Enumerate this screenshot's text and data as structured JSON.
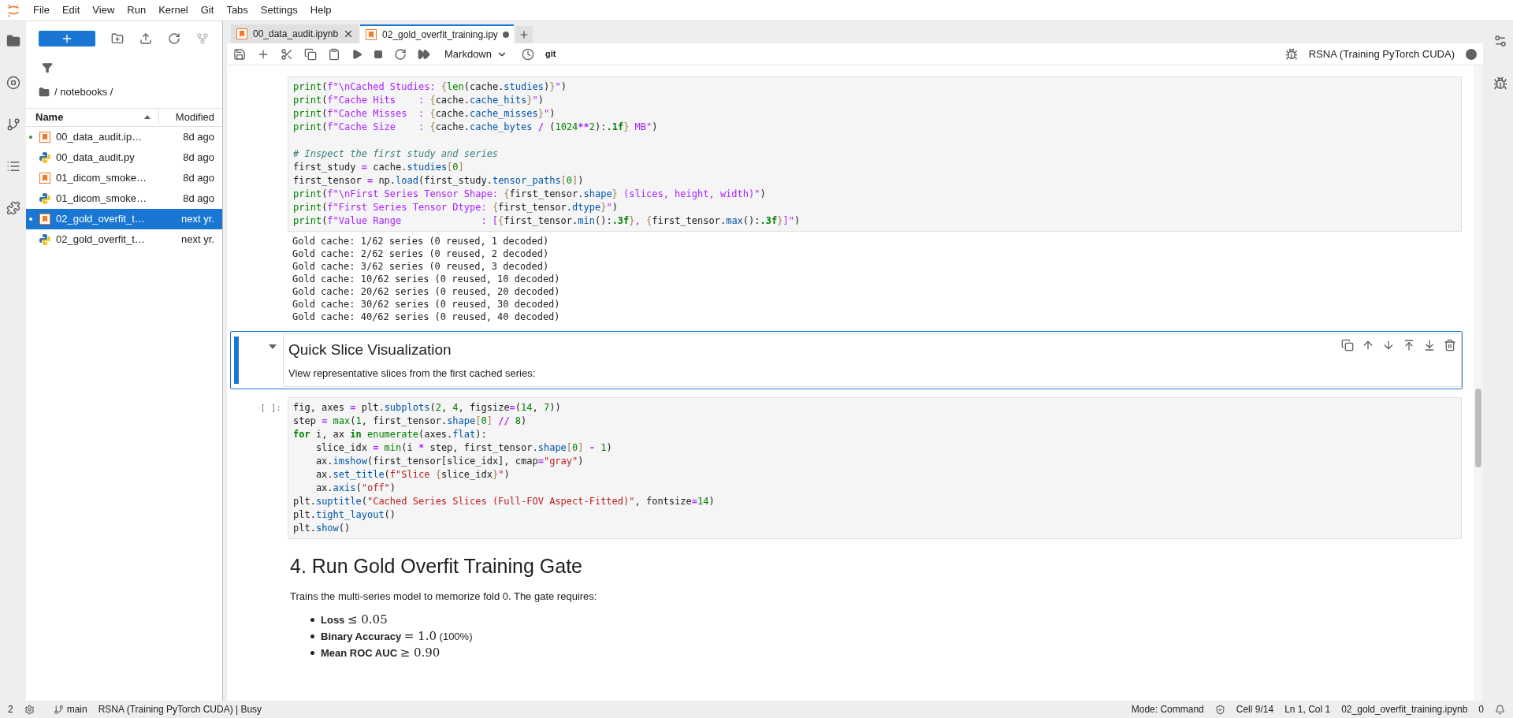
{
  "menu": [
    "File",
    "Edit",
    "View",
    "Run",
    "Kernel",
    "Git",
    "Tabs",
    "Settings",
    "Help"
  ],
  "file_browser": {
    "breadcrumb": "/ notebooks /",
    "columns": {
      "name": "Name",
      "modified": "Modified"
    },
    "files": [
      {
        "name": "00_data_audit.ip…",
        "modified": "8d ago",
        "kind": "notebook",
        "running": true,
        "selected": false
      },
      {
        "name": "00_data_audit.py",
        "modified": "8d ago",
        "kind": "python",
        "running": false,
        "selected": false
      },
      {
        "name": "01_dicom_smoke…",
        "modified": "8d ago",
        "kind": "notebook",
        "running": false,
        "selected": false
      },
      {
        "name": "01_dicom_smoke…",
        "modified": "8d ago",
        "kind": "python",
        "running": false,
        "selected": false
      },
      {
        "name": "02_gold_overfit_t…",
        "modified": "next yr.",
        "kind": "notebook",
        "running": true,
        "selected": true
      },
      {
        "name": "02_gold_overfit_t…",
        "modified": "next yr.",
        "kind": "python",
        "running": false,
        "selected": false
      }
    ]
  },
  "tabs": [
    {
      "label": "00_data_audit.ipynb",
      "selected": false,
      "unsaved": false
    },
    {
      "label": "02_gold_overfit_training.ipy",
      "selected": true,
      "unsaved": true
    }
  ],
  "toolbar": {
    "cell_type": "Markdown",
    "git": "git",
    "kernel": "RSNA (Training PyTorch CUDA)",
    "kernel_busy": true
  },
  "cells": [
    {
      "kind": "code",
      "blocks": [
        [
          [
            {
              "kind": "builtin",
              "text": "print"
            },
            {
              "kind": "text",
              "text": "("
            },
            {
              "kind": "fstring",
              "text": "f\"\\nCached Studies: "
            },
            {
              "kind": "brace",
              "text": "{"
            },
            {
              "kind": "builtin",
              "text": "len"
            },
            {
              "kind": "text",
              "text": "(cache."
            },
            {
              "kind": "attr",
              "text": "studies"
            },
            {
              "kind": "text",
              "text": ")"
            },
            {
              "kind": "brace",
              "text": "}"
            },
            {
              "kind": "fstring",
              "text": "\""
            },
            {
              "kind": "text",
              "text": ")"
            }
          ],
          [
            {
              "kind": "builtin",
              "text": "print"
            },
            {
              "kind": "text",
              "text": "("
            },
            {
              "kind": "fstring",
              "text": "f\"Cache Hits    : "
            },
            {
              "kind": "brace",
              "text": "{"
            },
            {
              "kind": "text",
              "text": "cache."
            },
            {
              "kind": "attr",
              "text": "cache_hits"
            },
            {
              "kind": "brace",
              "text": "}"
            },
            {
              "kind": "fstring",
              "text": "\""
            },
            {
              "kind": "text",
              "text": ")"
            }
          ],
          [
            {
              "kind": "builtin",
              "text": "print"
            },
            {
              "kind": "text",
              "text": "("
            },
            {
              "kind": "fstring",
              "text": "f\"Cache Misses  : "
            },
            {
              "kind": "brace",
              "text": "{"
            },
            {
              "kind": "text",
              "text": "cache."
            },
            {
              "kind": "attr",
              "text": "cache_misses"
            },
            {
              "kind": "brace",
              "text": "}"
            },
            {
              "kind": "fstring",
              "text": "\""
            },
            {
              "kind": "text",
              "text": ")"
            }
          ],
          [
            {
              "kind": "builtin",
              "text": "print"
            },
            {
              "kind": "text",
              "text": "("
            },
            {
              "kind": "fstring",
              "text": "f\"Cache Size    : "
            },
            {
              "kind": "brace",
              "text": "{"
            },
            {
              "kind": "text",
              "text": "cache."
            },
            {
              "kind": "attr",
              "text": "cache_bytes"
            },
            {
              "kind": "operator",
              "text": " / "
            },
            {
              "kind": "text",
              "text": "("
            },
            {
              "kind": "number",
              "text": "1024"
            },
            {
              "kind": "operator",
              "text": "**"
            },
            {
              "kind": "number",
              "text": "2"
            },
            {
              "kind": "text",
              "text": "):"
            },
            {
              "kind": "keyword",
              "text": ".1f"
            },
            {
              "kind": "brace",
              "text": "}"
            },
            {
              "kind": "fstring",
              "text": " MB\""
            },
            {
              "kind": "text",
              "text": ")"
            }
          ]
        ],
        [
          [
            {
              "kind": "comment",
              "text": "# Inspect the first study and series"
            }
          ],
          [
            {
              "kind": "text",
              "text": "first_study"
            },
            {
              "kind": "operator",
              "text": " = "
            },
            {
              "kind": "text",
              "text": "cache."
            },
            {
              "kind": "attr",
              "text": "studies"
            },
            {
              "kind": "brace",
              "text": "["
            },
            {
              "kind": "number",
              "text": "0"
            },
            {
              "kind": "brace",
              "text": "]"
            }
          ],
          [
            {
              "kind": "text",
              "text": "first_tensor"
            },
            {
              "kind": "operator",
              "text": " = "
            },
            {
              "kind": "text",
              "text": "np."
            },
            {
              "kind": "attr",
              "text": "load"
            },
            {
              "kind": "text",
              "text": "(first_study."
            },
            {
              "kind": "attr",
              "text": "tensor_paths"
            },
            {
              "kind": "brace",
              "text": "["
            },
            {
              "kind": "number",
              "text": "0"
            },
            {
              "kind": "brace",
              "text": "]"
            },
            {
              "kind": "text",
              "text": ")"
            }
          ],
          [
            {
              "kind": "builtin",
              "text": "print"
            },
            {
              "kind": "text",
              "text": "("
            },
            {
              "kind": "fstring",
              "text": "f\"\\nFirst Series Tensor Shape: "
            },
            {
              "kind": "brace",
              "text": "{"
            },
            {
              "kind": "text",
              "text": "first_tensor."
            },
            {
              "kind": "attr",
              "text": "shape"
            },
            {
              "kind": "brace",
              "text": "}"
            },
            {
              "kind": "fstring",
              "text": " (slices, height, width)\""
            },
            {
              "kind": "text",
              "text": ")"
            }
          ],
          [
            {
              "kind": "builtin",
              "text": "print"
            },
            {
              "kind": "text",
              "text": "("
            },
            {
              "kind": "fstring",
              "text": "f\"First Series Tensor Dtype: "
            },
            {
              "kind": "brace",
              "text": "{"
            },
            {
              "kind": "text",
              "text": "first_tensor."
            },
            {
              "kind": "attr",
              "text": "dtype"
            },
            {
              "kind": "brace",
              "text": "}"
            },
            {
              "kind": "fstring",
              "text": "\""
            },
            {
              "kind": "text",
              "text": ")"
            }
          ],
          [
            {
              "kind": "builtin",
              "text": "print"
            },
            {
              "kind": "text",
              "text": "("
            },
            {
              "kind": "fstring",
              "text": "f\"Value Range              : ["
            },
            {
              "kind": "brace",
              "text": "{"
            },
            {
              "kind": "text",
              "text": "first_tensor."
            },
            {
              "kind": "attr",
              "text": "min"
            },
            {
              "kind": "text",
              "text": "():"
            },
            {
              "kind": "keyword",
              "text": ".3f"
            },
            {
              "kind": "brace",
              "text": "}"
            },
            {
              "kind": "fstring",
              "text": ", "
            },
            {
              "kind": "brace",
              "text": "{"
            },
            {
              "kind": "text",
              "text": "first_tensor."
            },
            {
              "kind": "attr",
              "text": "max"
            },
            {
              "kind": "text",
              "text": "():"
            },
            {
              "kind": "keyword",
              "text": ".3f"
            },
            {
              "kind": "brace",
              "text": "}"
            },
            {
              "kind": "fstring",
              "text": "]\""
            },
            {
              "kind": "text",
              "text": ")"
            }
          ]
        ]
      ],
      "output": [
        "Gold cache: 1/62 series (0 reused, 1 decoded)",
        "Gold cache: 2/62 series (0 reused, 2 decoded)",
        "Gold cache: 3/62 series (0 reused, 3 decoded)",
        "Gold cache: 10/62 series (0 reused, 10 decoded)",
        "Gold cache: 20/62 series (0 reused, 20 decoded)",
        "Gold cache: 30/62 series (0 reused, 30 decoded)",
        "Gold cache: 40/62 series (0 reused, 40 decoded)"
      ],
      "selected": false
    },
    {
      "kind": "markdown",
      "heading": "Quick Slice Visualization",
      "text": "View representative slices from the first cached series:",
      "selected": true
    },
    {
      "kind": "code",
      "prompt": "[ ]:",
      "blocks": [
        [
          [
            {
              "kind": "text",
              "text": "fig, axes"
            },
            {
              "kind": "operator",
              "text": " = "
            },
            {
              "kind": "text",
              "text": "plt."
            },
            {
              "kind": "attr",
              "text": "subplots"
            },
            {
              "kind": "text",
              "text": "("
            },
            {
              "kind": "number",
              "text": "2"
            },
            {
              "kind": "text",
              "text": ", "
            },
            {
              "kind": "number",
              "text": "4"
            },
            {
              "kind": "text",
              "text": ", figsize"
            },
            {
              "kind": "operator",
              "text": "="
            },
            {
              "kind": "text",
              "text": "("
            },
            {
              "kind": "number",
              "text": "14"
            },
            {
              "kind": "text",
              "text": ", "
            },
            {
              "kind": "number",
              "text": "7"
            },
            {
              "kind": "text",
              "text": "))"
            }
          ],
          [
            {
              "kind": "text",
              "text": "step"
            },
            {
              "kind": "operator",
              "text": " = "
            },
            {
              "kind": "builtin",
              "text": "max"
            },
            {
              "kind": "text",
              "text": "("
            },
            {
              "kind": "number",
              "text": "1"
            },
            {
              "kind": "text",
              "text": ", first_tensor."
            },
            {
              "kind": "attr",
              "text": "shape"
            },
            {
              "kind": "brace",
              "text": "["
            },
            {
              "kind": "number",
              "text": "0"
            },
            {
              "kind": "brace",
              "text": "]"
            },
            {
              "kind": "operator",
              "text": " // "
            },
            {
              "kind": "number",
              "text": "8"
            },
            {
              "kind": "text",
              "text": ")"
            }
          ],
          [
            {
              "kind": "keyword",
              "text": "for"
            },
            {
              "kind": "text",
              "text": " i, ax "
            },
            {
              "kind": "keyword",
              "text": "in"
            },
            {
              "kind": "builtin",
              "text": " enumerate"
            },
            {
              "kind": "text",
              "text": "(axes."
            },
            {
              "kind": "attr",
              "text": "flat"
            },
            {
              "kind": "text",
              "text": "):"
            }
          ],
          [
            {
              "kind": "text",
              "text": "    slice_idx"
            },
            {
              "kind": "operator",
              "text": " = "
            },
            {
              "kind": "builtin",
              "text": "min"
            },
            {
              "kind": "text",
              "text": "(i "
            },
            {
              "kind": "operator",
              "text": "*"
            },
            {
              "kind": "text",
              "text": " step, first_tensor."
            },
            {
              "kind": "attr",
              "text": "shape"
            },
            {
              "kind": "brace",
              "text": "["
            },
            {
              "kind": "number",
              "text": "0"
            },
            {
              "kind": "brace",
              "text": "]"
            },
            {
              "kind": "operator",
              "text": " - "
            },
            {
              "kind": "number",
              "text": "1"
            },
            {
              "kind": "text",
              "text": ")"
            }
          ],
          [
            {
              "kind": "text",
              "text": "    ax."
            },
            {
              "kind": "attr",
              "text": "imshow"
            },
            {
              "kind": "text",
              "text": "(first_tensor[slice_idx], cmap"
            },
            {
              "kind": "operator",
              "text": "="
            },
            {
              "kind": "string",
              "text": "\"gray\""
            },
            {
              "kind": "text",
              "text": ")"
            }
          ],
          [
            {
              "kind": "text",
              "text": "    ax."
            },
            {
              "kind": "attr",
              "text": "set_title"
            },
            {
              "kind": "text",
              "text": "("
            },
            {
              "kind": "string",
              "text": "f\"Slice "
            },
            {
              "kind": "brace",
              "text": "{"
            },
            {
              "kind": "text",
              "text": "slice_idx"
            },
            {
              "kind": "brace",
              "text": "}"
            },
            {
              "kind": "string",
              "text": "\""
            },
            {
              "kind": "text",
              "text": ")"
            }
          ],
          [
            {
              "kind": "text",
              "text": "    ax."
            },
            {
              "kind": "attr",
              "text": "axis"
            },
            {
              "kind": "text",
              "text": "("
            },
            {
              "kind": "string",
              "text": "\"off\""
            },
            {
              "kind": "text",
              "text": ")"
            }
          ],
          [
            {
              "kind": "text",
              "text": "plt."
            },
            {
              "kind": "attr",
              "text": "suptitle"
            },
            {
              "kind": "text",
              "text": "("
            },
            {
              "kind": "string",
              "text": "\"Cached Series Slices (Full-FOV Aspect-Fitted)\""
            },
            {
              "kind": "text",
              "text": ", fontsize"
            },
            {
              "kind": "operator",
              "text": "="
            },
            {
              "kind": "number",
              "text": "14"
            },
            {
              "kind": "text",
              "text": ")"
            }
          ],
          [
            {
              "kind": "text",
              "text": "plt."
            },
            {
              "kind": "attr",
              "text": "tight_layout"
            },
            {
              "kind": "text",
              "text": "()"
            }
          ],
          [
            {
              "kind": "text",
              "text": "plt."
            },
            {
              "kind": "attr",
              "text": "show"
            },
            {
              "kind": "text",
              "text": "()"
            }
          ]
        ]
      ],
      "selected": false
    },
    {
      "kind": "doc",
      "heading": "4. Run Gold Overfit Training Gate",
      "text": "Trains the multi-series model to memorize fold 0. The gate requires:",
      "bullets": [
        {
          "label": "Loss",
          "math": "≤ 0.05"
        },
        {
          "label": "Binary Accuracy",
          "math": "= 1.0",
          "note": "(100%)"
        },
        {
          "label": "Mean ROC AUC",
          "math": "≥ 0.90"
        }
      ],
      "selected": false
    }
  ],
  "status": {
    "terminals": "2",
    "branch": "main",
    "kernel": "RSNA (Training PyTorch CUDA) | Busy",
    "mode": "Mode: Command",
    "cell": "Cell 9/14",
    "position": "Ln 1, Col 1",
    "file": "02_gold_overfit_training.ipynb",
    "notifications": "0"
  }
}
